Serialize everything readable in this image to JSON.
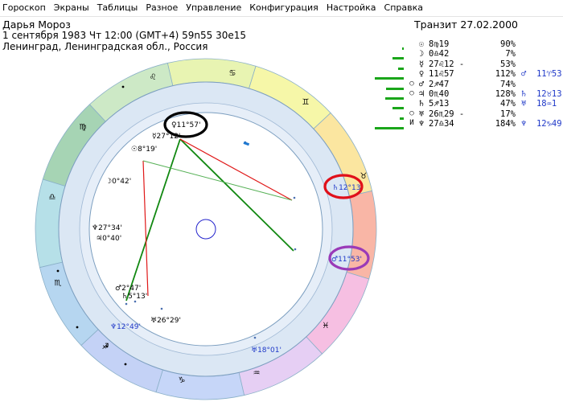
{
  "menu": [
    "Гороскоп",
    "Экраны",
    "Таблицы",
    "Разное",
    "Управление",
    "Конфигурация",
    "Настройка",
    "Справка"
  ],
  "person": {
    "name": "Дарья Мороз",
    "line2": "1 сентября 1983  Чт  12:00 (GMT+4) 59n55  30e15",
    "line3": "Ленинград, Ленинградская обл., Россия"
  },
  "transit_title": "Транзит 27.02.2000",
  "planets": [
    {
      "icon": "sun-icon",
      "symbol": "☉",
      "marker": "",
      "position": "8♍19",
      "strength": "90%",
      "bar": 0.05,
      "rulership": ""
    },
    {
      "icon": "moon-icon",
      "symbol": "☽",
      "marker": "",
      "position": "0♎42",
      "strength": "7%",
      "bar": 0.4,
      "rulership": ""
    },
    {
      "icon": "mercury-icon",
      "symbol": "☿",
      "marker": "",
      "position": "27♌12 -",
      "strength": "53%",
      "bar": 0.2,
      "rulership": ""
    },
    {
      "icon": "venus-icon",
      "symbol": "♀",
      "marker": "",
      "position": "11♌57",
      "strength": "112%",
      "bar": 1.0,
      "rulership": "♂  11♈53"
    },
    {
      "icon": "mars-icon",
      "symbol": "♂",
      "marker": "○",
      "position": "2♐47",
      "strength": "74%",
      "bar": 0.6,
      "rulership": ""
    },
    {
      "icon": "jupiter-icon",
      "symbol": "♃",
      "marker": "○",
      "position": "0♏40",
      "strength": "128%",
      "bar": 0.65,
      "rulership": "♄  12♉13"
    },
    {
      "icon": "saturn-icon",
      "symbol": "♄",
      "marker": "",
      "position": "5♐13",
      "strength": "47%",
      "bar": 0.4,
      "rulership": "♅  18♒1"
    },
    {
      "icon": "uranus-icon",
      "symbol": "♅",
      "marker": "○",
      "position": "26♏29 -",
      "strength": "17%",
      "bar": 0.15,
      "rulership": ""
    },
    {
      "icon": "neptune-icon",
      "symbol": "♆",
      "marker": "И",
      "position": "27♎34",
      "strength": "184%",
      "bar": 1.0,
      "rulership": "♆  12♑49"
    }
  ],
  "zodiac": [
    {
      "name": "aries",
      "symbol": "♈"
    },
    {
      "name": "taurus",
      "symbol": "♉"
    },
    {
      "name": "gemini",
      "symbol": "♊"
    },
    {
      "name": "cancer",
      "symbol": "♋"
    },
    {
      "name": "leo",
      "symbol": "♌"
    },
    {
      "name": "virgo",
      "symbol": "♍"
    },
    {
      "name": "libra",
      "symbol": "♎"
    },
    {
      "name": "scorpio",
      "symbol": "♏"
    },
    {
      "name": "sagittarius",
      "symbol": "♐"
    },
    {
      "name": "capricorn",
      "symbol": "♑"
    },
    {
      "name": "aquarius",
      "symbol": "♒"
    },
    {
      "name": "pisces",
      "symbol": "♓"
    }
  ],
  "zodiac_colors": [
    "#f9b6a6",
    "#fbe6a0",
    "#f6f7a8",
    "#e8f4b2",
    "#cde9c6",
    "#a6d4b4",
    "#b6e0e8",
    "#b6d6f0",
    "#c4d2f6",
    "#c6d6f8",
    "#e6cff4",
    "#f6bfe2"
  ],
  "inner_planets": [
    {
      "name": "natal-sun",
      "label": "☉8°19'"
    },
    {
      "name": "natal-moon",
      "label": "☽0°42'"
    },
    {
      "name": "natal-mercury",
      "label": "☿27°12'"
    },
    {
      "name": "natal-venus",
      "label": "♀11°57'"
    },
    {
      "name": "natal-mars",
      "label": "♂2°47'"
    },
    {
      "name": "natal-jupiter",
      "label": "♃0°40'"
    },
    {
      "name": "natal-saturn",
      "label": "♄5°13'"
    },
    {
      "name": "natal-uranus",
      "label": "♅26°29'"
    },
    {
      "name": "natal-neptune",
      "label": "♆27°34'"
    }
  ],
  "outer_planets": [
    {
      "name": "transit-mars",
      "label": "♂11°53'"
    },
    {
      "name": "transit-saturn",
      "label": "♄12°13'"
    },
    {
      "name": "transit-uranus",
      "label": "♅18°01'"
    },
    {
      "name": "transit-neptune",
      "label": "♆12°49'"
    }
  ],
  "aspect_colors": {
    "green": "#118811",
    "red": "#e01818",
    "light_green": "#55b055"
  },
  "highlight_colors": {
    "black": "#000000",
    "red": "#e0101a",
    "purple": "#9a3ab8"
  }
}
